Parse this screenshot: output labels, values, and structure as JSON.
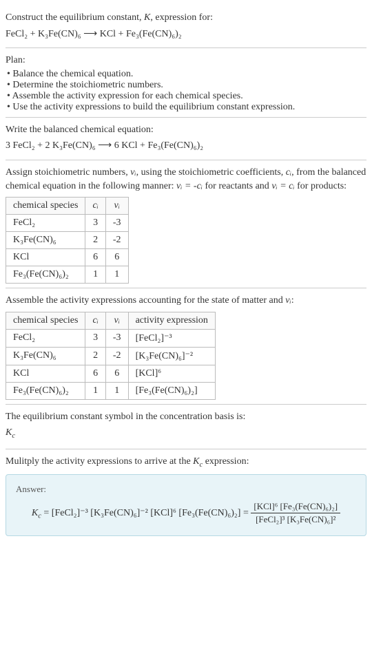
{
  "intro": {
    "line1_a": "Construct the equilibrium constant, ",
    "K": "K",
    "line1_b": ", expression for:",
    "reaction": "FeCl₂ + K₃Fe(CN)₆ ⟶ KCl + Fe₃(Fe(CN)₆)₂"
  },
  "plan": {
    "title": "Plan:",
    "items": [
      "Balance the chemical equation.",
      "Determine the stoichiometric numbers.",
      "Assemble the activity expression for each chemical species.",
      "Use the activity expressions to build the equilibrium constant expression."
    ]
  },
  "balanced": {
    "title": "Write the balanced chemical equation:",
    "eq": "3 FeCl₂ + 2 K₃Fe(CN)₆ ⟶ 6 KCl + Fe₃(Fe(CN)₆)₂"
  },
  "stoich": {
    "desc_a": "Assign stoichiometric numbers, ",
    "nu_i": "νᵢ",
    "desc_b": ", using the stoichiometric coefficients, ",
    "c_i": "cᵢ",
    "desc_c": ", from the balanced chemical equation in the following manner: ",
    "rel1": "νᵢ = -cᵢ",
    "desc_d": " for reactants and ",
    "rel2": "νᵢ = cᵢ",
    "desc_e": " for products:",
    "headers": {
      "species": "chemical species",
      "c": "cᵢ",
      "nu": "νᵢ"
    },
    "rows": [
      {
        "species": "FeCl₂",
        "c": "3",
        "nu": "-3"
      },
      {
        "species": "K₃Fe(CN)₆",
        "c": "2",
        "nu": "-2"
      },
      {
        "species": "KCl",
        "c": "6",
        "nu": "6"
      },
      {
        "species": "Fe₃(Fe(CN)₆)₂",
        "c": "1",
        "nu": "1"
      }
    ]
  },
  "activity": {
    "title_a": "Assemble the activity expressions accounting for the state of matter and ",
    "nu_i": "νᵢ",
    "title_b": ":",
    "headers": {
      "species": "chemical species",
      "c": "cᵢ",
      "nu": "νᵢ",
      "act": "activity expression"
    },
    "rows": [
      {
        "species": "FeCl₂",
        "c": "3",
        "nu": "-3",
        "act": "[FeCl₂]⁻³"
      },
      {
        "species": "K₃Fe(CN)₆",
        "c": "2",
        "nu": "-2",
        "act": "[K₃Fe(CN)₆]⁻²"
      },
      {
        "species": "KCl",
        "c": "6",
        "nu": "6",
        "act": "[KCl]⁶"
      },
      {
        "species": "Fe₃(Fe(CN)₆)₂",
        "c": "1",
        "nu": "1",
        "act": "[Fe₃(Fe(CN)₆)₂]"
      }
    ]
  },
  "symbol": {
    "title": "The equilibrium constant symbol in the concentration basis is:",
    "Kc": "K",
    "Kc_sub": "c"
  },
  "multiply": {
    "title_a": "Mulitply the activity expressions to arrive at the ",
    "Kc": "K",
    "Kc_sub": "c",
    "title_b": " expression:"
  },
  "answer": {
    "label": "Answer:",
    "Kc": "K",
    "Kc_sub": "c",
    "eq_lhs": " = [FeCl₂]⁻³ [K₃Fe(CN)₆]⁻² [KCl]⁶ [Fe₃(Fe(CN)₆)₂] = ",
    "frac_num": "[KCl]⁶ [Fe₃(Fe(CN)₆)₂]",
    "frac_den": "[FeCl₂]³ [K₃Fe(CN)₆]²"
  }
}
